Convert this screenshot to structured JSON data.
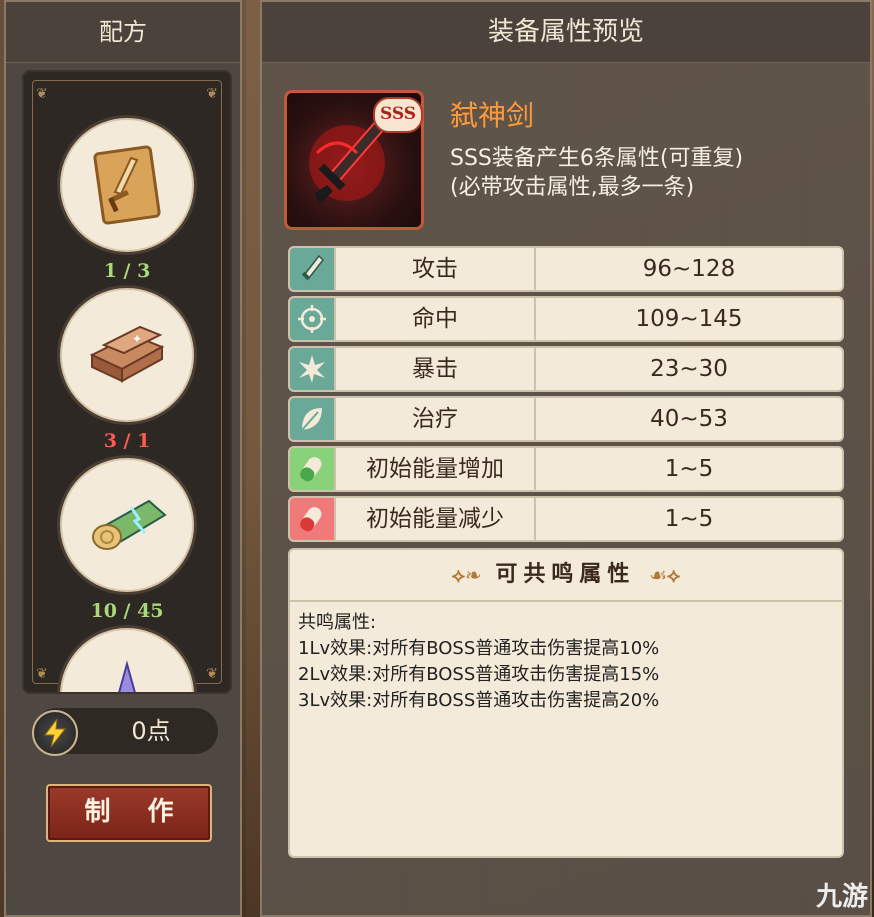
{
  "recipe_panel": {
    "title": "配方",
    "items": [
      {
        "icon": "sword-scroll-icon",
        "count": "1 / 3",
        "status": "ok"
      },
      {
        "icon": "ore-ingots-icon",
        "count": "3 / 1",
        "status": "bad"
      },
      {
        "icon": "glowing-log-icon",
        "count": "10 / 45",
        "status": "ok"
      },
      {
        "icon": "crystal-icon",
        "count": "",
        "status": "ok"
      }
    ],
    "energy": {
      "icon": "lightning-icon",
      "value": "0点"
    },
    "craft_button": "制 作"
  },
  "preview_panel": {
    "title": "装备属性预览",
    "equipment": {
      "name": "弑神剑",
      "rank": "SSS",
      "description_line1": "SSS装备产生6条属性(可重复)",
      "description_line2": "(必带攻击属性,最多一条)"
    },
    "stats": [
      {
        "name": "攻击",
        "range": "96~128",
        "icon": "sword-icon"
      },
      {
        "name": "命中",
        "range": "109~145",
        "icon": "crosshair-icon"
      },
      {
        "name": "暴击",
        "range": "23~30",
        "icon": "burst-icon"
      },
      {
        "name": "治疗",
        "range": "40~53",
        "icon": "leaf-icon"
      },
      {
        "name": "初始能量增加",
        "range": "1~5",
        "icon": "green-capsule-icon"
      },
      {
        "name": "初始能量减少",
        "range": "1~5",
        "icon": "red-capsule-icon"
      }
    ],
    "resonance": {
      "header": "可共鸣属性",
      "label": "共鸣属性:",
      "lines": [
        "1Lv效果:对所有BOSS普通攻击伤害提高10%",
        "2Lv效果:对所有BOSS普通攻击伤害提高15%",
        "3Lv效果:对所有BOSS普通攻击伤害提高20%"
      ]
    }
  },
  "watermark": "九游",
  "colors": {
    "accent_orange": "#ff9a3a",
    "bad_red": "#ff5b4a",
    "ok_green": "#a8d87a"
  }
}
